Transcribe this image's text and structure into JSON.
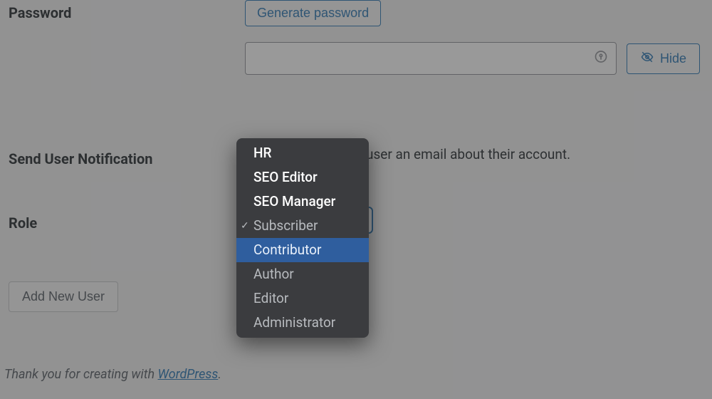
{
  "password": {
    "label": "Password",
    "generate_label": "Generate password",
    "value": "",
    "hide_label": "Hide"
  },
  "notification": {
    "label": "Send User Notification",
    "text_suffix": "user an email about their account."
  },
  "role": {
    "label": "Role",
    "options_top": [
      "HR",
      "SEO Editor",
      "SEO Manager"
    ],
    "options_bottom": [
      "Subscriber",
      "Contributor",
      "Author",
      "Editor",
      "Administrator"
    ],
    "selected": "Subscriber",
    "highlighted": "Contributor"
  },
  "submit": {
    "label": "Add New User"
  },
  "footer": {
    "prefix": "Thank you for creating with ",
    "link_text": "WordPress",
    "suffix": "."
  }
}
